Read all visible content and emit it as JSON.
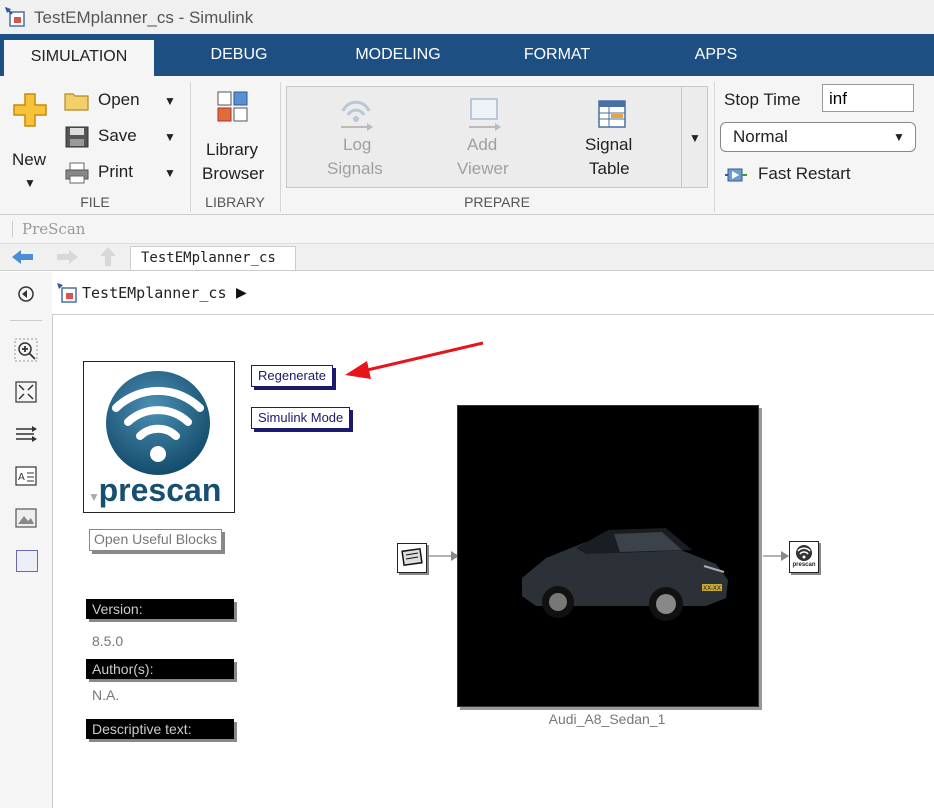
{
  "window": {
    "title": "TestEMplanner_cs - Simulink"
  },
  "tabs": [
    "SIMULATION",
    "DEBUG",
    "MODELING",
    "FORMAT",
    "APPS"
  ],
  "ribbon": {
    "file": {
      "new_label": "New",
      "open_label": "Open",
      "save_label": "Save",
      "print_label": "Print",
      "group_label": "FILE"
    },
    "library": {
      "line1": "Library",
      "line2": "Browser",
      "group_label": "LIBRARY"
    },
    "prepare": {
      "log_signals": [
        "Log",
        "Signals"
      ],
      "add_viewer": [
        "Add",
        "Viewer"
      ],
      "signal_table": [
        "Signal",
        "Table"
      ],
      "group_label": "PREPARE"
    },
    "simulate": {
      "stop_time_label": "Stop Time",
      "stop_time_value": "inf",
      "mode_value": "Normal",
      "fast_restart_label": "Fast Restart"
    }
  },
  "toolstrip": {
    "prescan_label": "PreScan"
  },
  "nav": {
    "model_tab": "TestEMplanner_cs"
  },
  "address": {
    "path": "TestEMplanner_cs"
  },
  "canvas": {
    "prescan_logo_text": "prescan",
    "regenerate_button": "Regenerate",
    "simulink_mode_button": "Simulink Mode",
    "open_useful_blocks_button": "Open Useful Blocks",
    "version_label": "Version:",
    "version_value": "8.5.0",
    "authors_label": "Author(s):",
    "authors_value": "N.A.",
    "descriptive_label": "Descriptive text:",
    "vehicle_block_name": "Audi_A8_Sedan_1",
    "vehicle_plate": "XX-XX",
    "small_prescan_text": "prescan"
  },
  "colors": {
    "tab_bar": "#1d4f82",
    "annotation_arrow": "#e8141c",
    "mask_button_border": "#1a1a6e"
  }
}
